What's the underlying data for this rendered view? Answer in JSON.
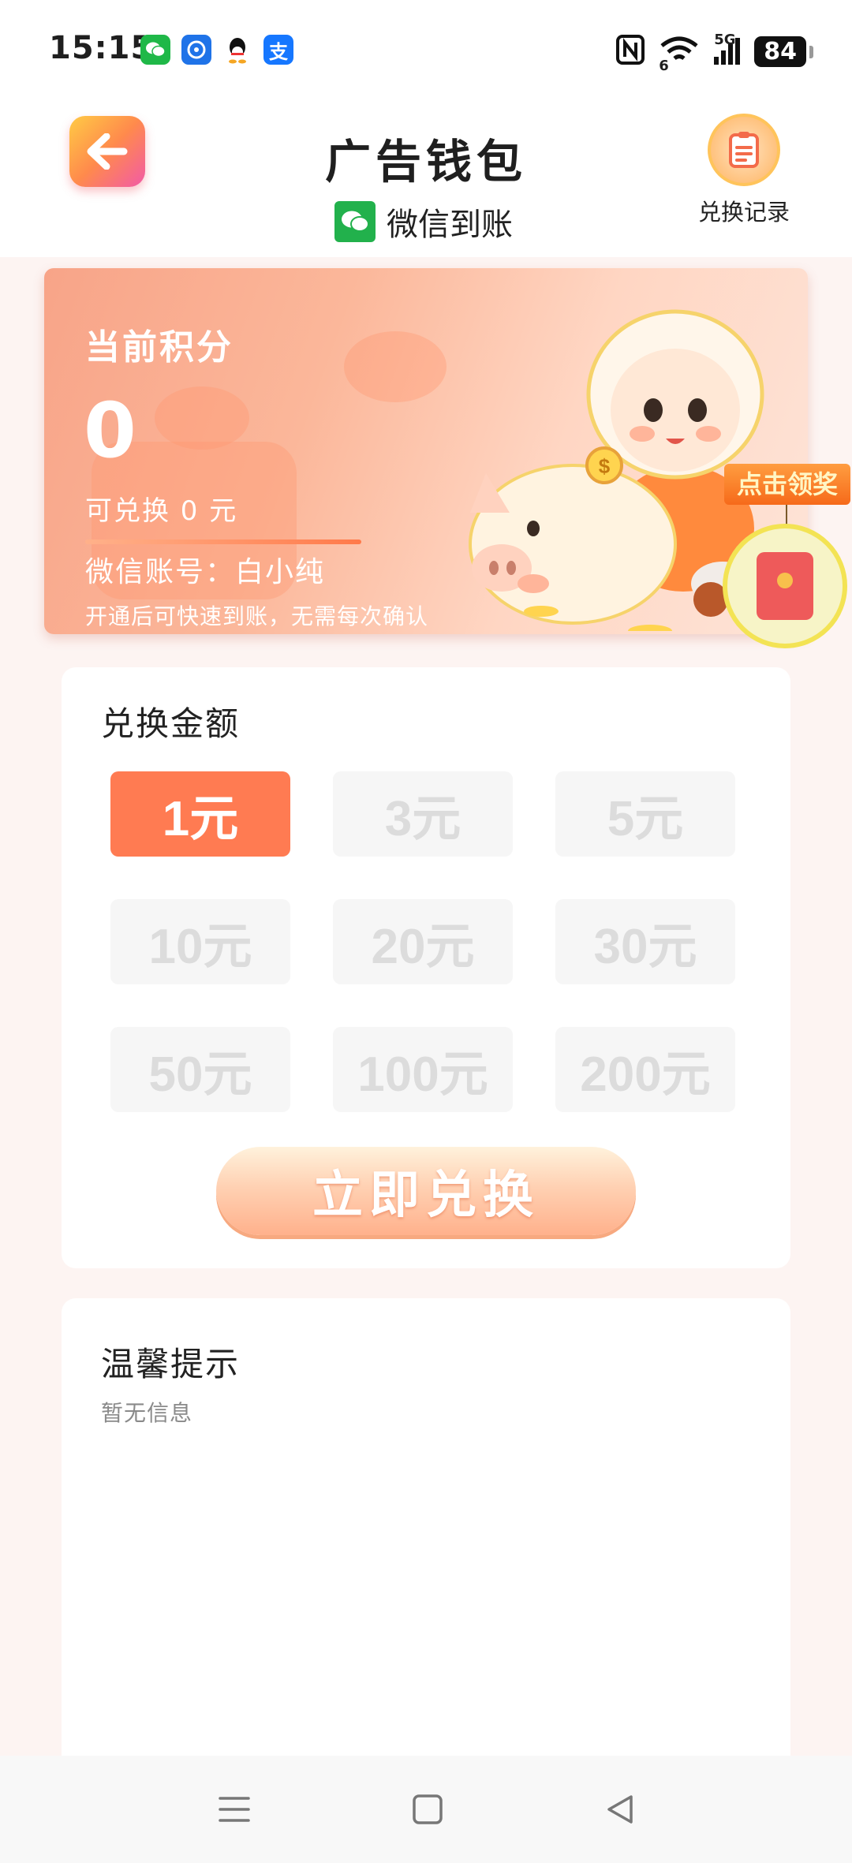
{
  "status_bar": {
    "time": "15:15",
    "notification_icons": [
      "wechat-icon",
      "pinwheel-app-icon",
      "qq-icon",
      "alipay-icon"
    ],
    "alipay_glyph": "支",
    "network": "5G",
    "wifi_sub": "6",
    "battery": "84"
  },
  "header": {
    "title": "广告钱包",
    "subtitle": "微信到账",
    "record_label": "兑换记录"
  },
  "points_card": {
    "label": "当前积分",
    "value": "0",
    "redeemable": "可兑换 0 元",
    "account": "微信账号：白小纯",
    "tip": "开通后可快速到账，无需每次确认"
  },
  "float_reward": {
    "tag": "点击领奖"
  },
  "amount_section": {
    "title": "兑换金额",
    "options": [
      "1元",
      "3元",
      "5元",
      "10元",
      "20元",
      "30元",
      "50元",
      "100元",
      "200元"
    ],
    "selected": "1元",
    "redeem_button": "立即兑换"
  },
  "tips_section": {
    "title": "温馨提示",
    "text": "暂无信息"
  },
  "colors": {
    "accent": "#ff7b52",
    "wechat_green": "#22b14c",
    "card_gradient_start": "#f8a488"
  }
}
